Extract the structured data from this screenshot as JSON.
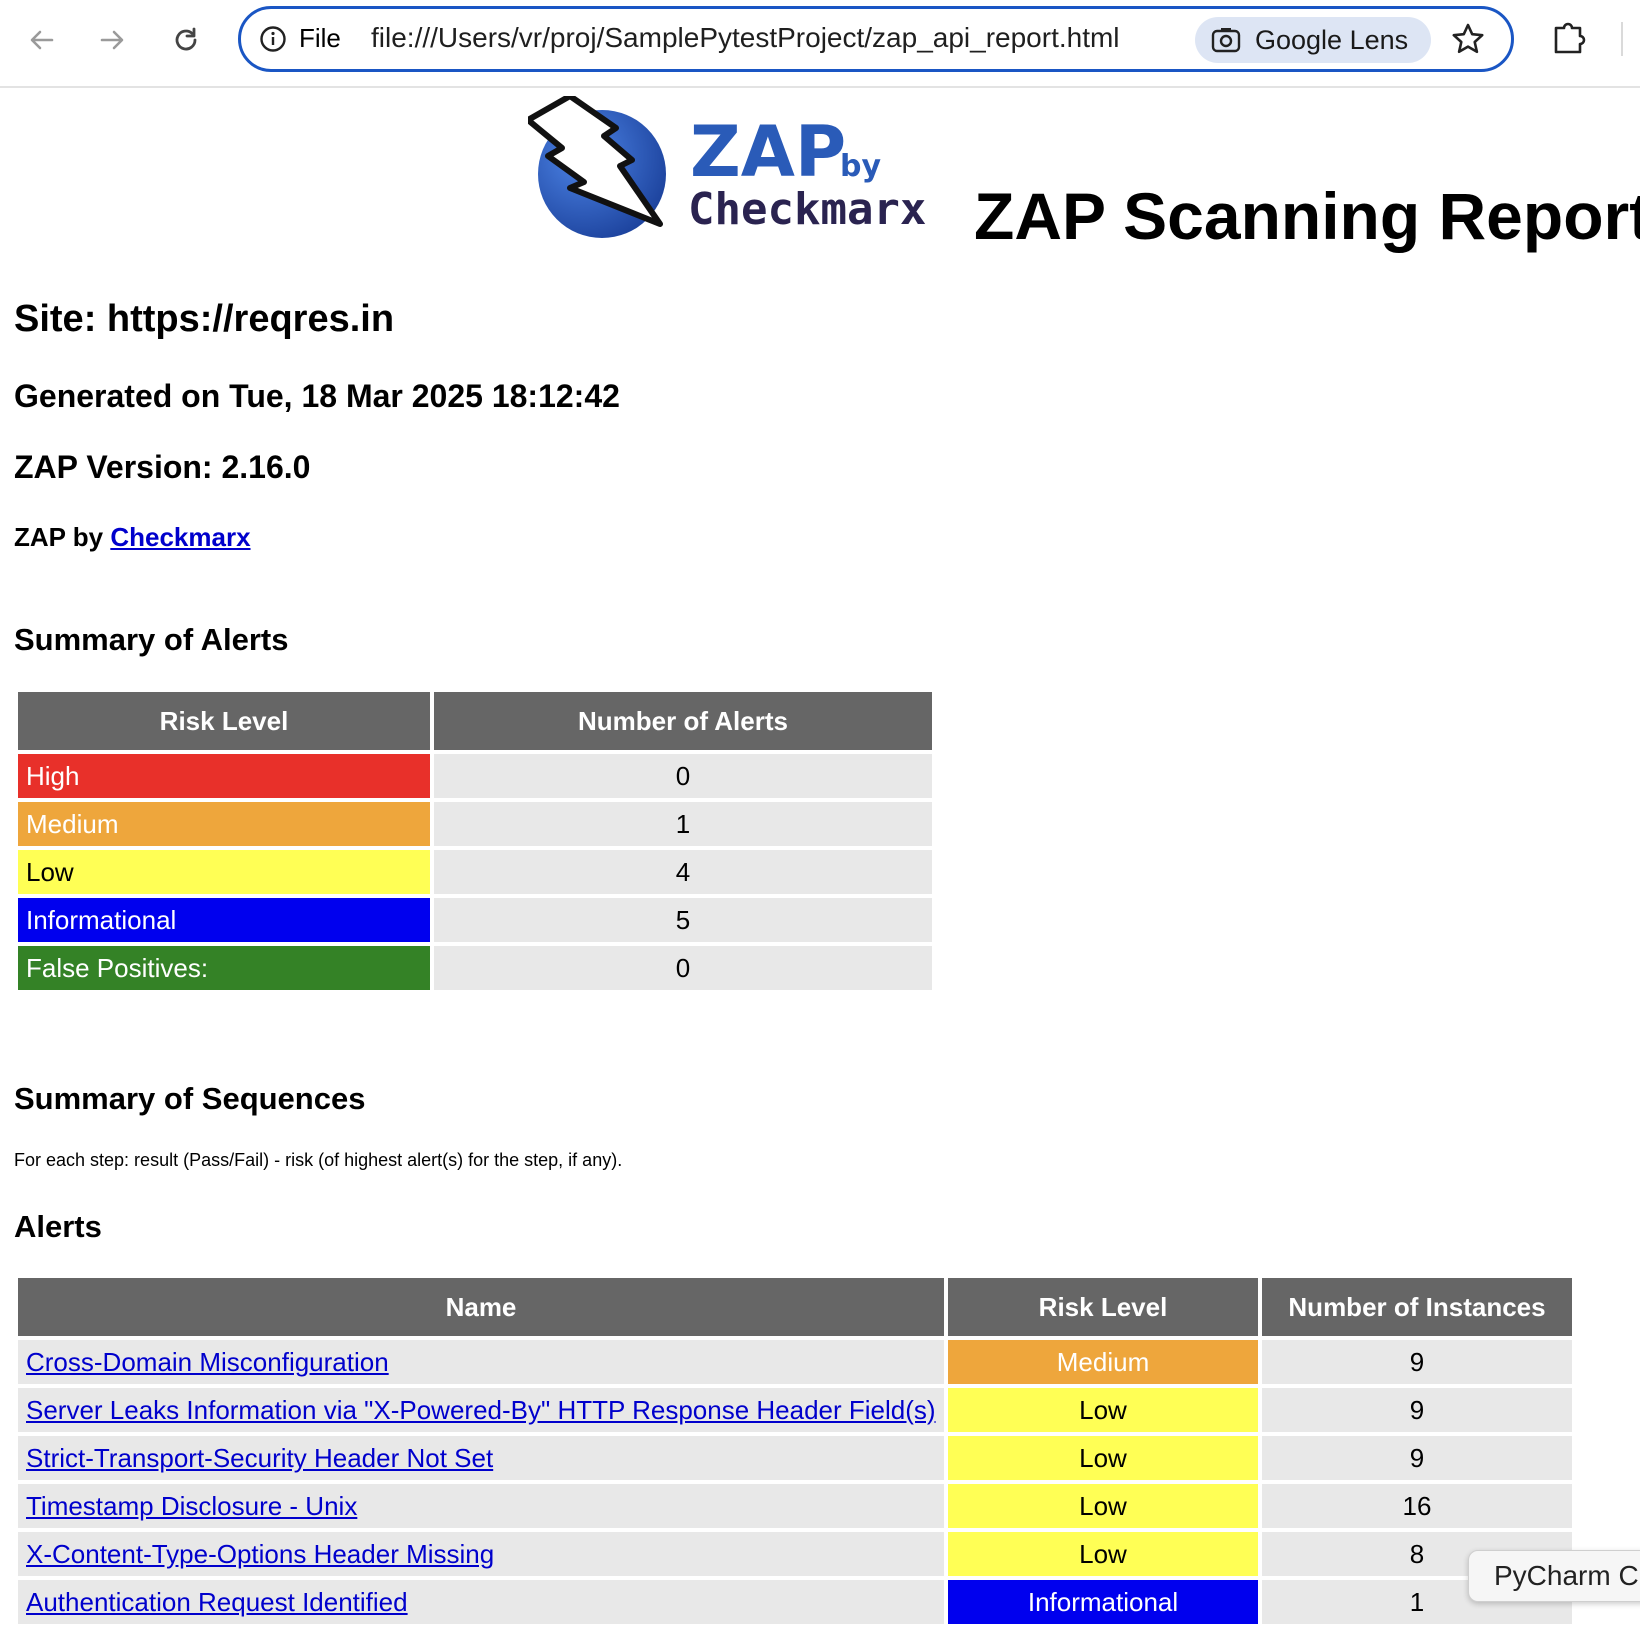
{
  "browser": {
    "back_icon": "arrow-left-icon",
    "forward_icon": "arrow-right-icon",
    "reload_icon": "reload-icon",
    "info_icon": "info-icon",
    "scheme_label": "File",
    "url": "file:///Users/vr/proj/SamplePytestProject/zap_api_report.html",
    "lens_label": "Google Lens",
    "bookmark_icon": "star-icon",
    "extension_icon": "puzzle-icon"
  },
  "logo": {
    "zap": "ZAP",
    "by": "by",
    "company": "Checkmarx"
  },
  "report": {
    "title": "ZAP Scanning Report",
    "site": "Site: https://reqres.in",
    "generated": "Generated on Tue, 18 Mar 2025 18:12:42",
    "version": "ZAP Version: 2.16.0",
    "by_prefix": "ZAP by ",
    "by_link": "Checkmarx"
  },
  "summary_of_alerts": {
    "heading": "Summary of Alerts",
    "columns": [
      "Risk Level",
      "Number of Alerts"
    ],
    "rows": [
      {
        "level": "High",
        "count": "0",
        "color": "#e8302a"
      },
      {
        "level": "Medium",
        "count": "1",
        "color": "#eea63c"
      },
      {
        "level": "Low",
        "count": "4",
        "color": "#ffff55"
      },
      {
        "level": "Informational",
        "count": "5",
        "color": "#0000ee"
      },
      {
        "level": "False Positives:",
        "count": "0",
        "color": "#348226"
      }
    ]
  },
  "summary_of_sequences": {
    "heading": "Summary of Sequences",
    "note": "For each step: result (Pass/Fail) - risk (of highest alert(s) for the step, if any)."
  },
  "alerts": {
    "heading": "Alerts",
    "columns": [
      "Name",
      "Risk Level",
      "Number of Instances"
    ],
    "rows": [
      {
        "name": "Cross-Domain Misconfiguration",
        "risk": "Medium",
        "instances": "9"
      },
      {
        "name": "Server Leaks Information via \"X-Powered-By\" HTTP Response Header Field(s)",
        "risk": "Low",
        "instances": "9"
      },
      {
        "name": "Strict-Transport-Security Header Not Set",
        "risk": "Low",
        "instances": "9"
      },
      {
        "name": "Timestamp Disclosure - Unix",
        "risk": "Low",
        "instances": "16"
      },
      {
        "name": "X-Content-Type-Options Header Missing",
        "risk": "Low",
        "instances": "8"
      },
      {
        "name": "Authentication Request Identified",
        "risk": "Informational",
        "instances": "1"
      }
    ]
  },
  "tooltip": {
    "text": "PyCharm C"
  }
}
